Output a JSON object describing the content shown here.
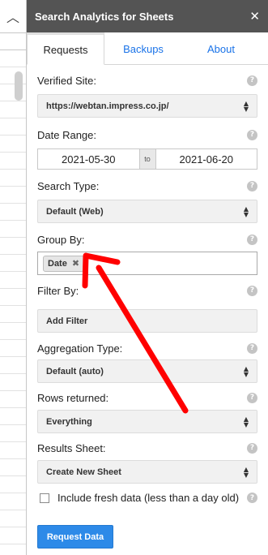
{
  "sheet": {
    "chevron_icon": "chevron-up-icon"
  },
  "header": {
    "title": "Search Analytics for Sheets",
    "close_icon": "close-icon"
  },
  "tabs": [
    {
      "label": "Requests",
      "active": true
    },
    {
      "label": "Backups",
      "active": false
    },
    {
      "label": "About",
      "active": false
    }
  ],
  "form": {
    "verified_site": {
      "label": "Verified Site:",
      "value": "https://webtan.impress.co.jp/"
    },
    "date_range": {
      "label": "Date Range:",
      "start": "2021-05-30",
      "separator": "to",
      "end": "2021-06-20"
    },
    "search_type": {
      "label": "Search Type:",
      "value": "Default (Web)"
    },
    "group_by": {
      "label": "Group By:",
      "chips": [
        "Date"
      ]
    },
    "filter_by": {
      "label": "Filter By:",
      "add_button": "Add Filter"
    },
    "aggregation_type": {
      "label": "Aggregation Type:",
      "value": "Default (auto)"
    },
    "rows_returned": {
      "label": "Rows returned:",
      "value": "Everything"
    },
    "results_sheet": {
      "label": "Results Sheet:",
      "value": "Create New Sheet"
    },
    "fresh_data": {
      "label": "Include fresh data (less than a day old)",
      "checked": false
    },
    "submit": "Request Data"
  },
  "colors": {
    "header_bg": "#545454",
    "primary_button": "#2d8ae8",
    "tab_link": "#1a73e8",
    "annotation_arrow": "#ff0000"
  },
  "help_icon_glyph": "?"
}
